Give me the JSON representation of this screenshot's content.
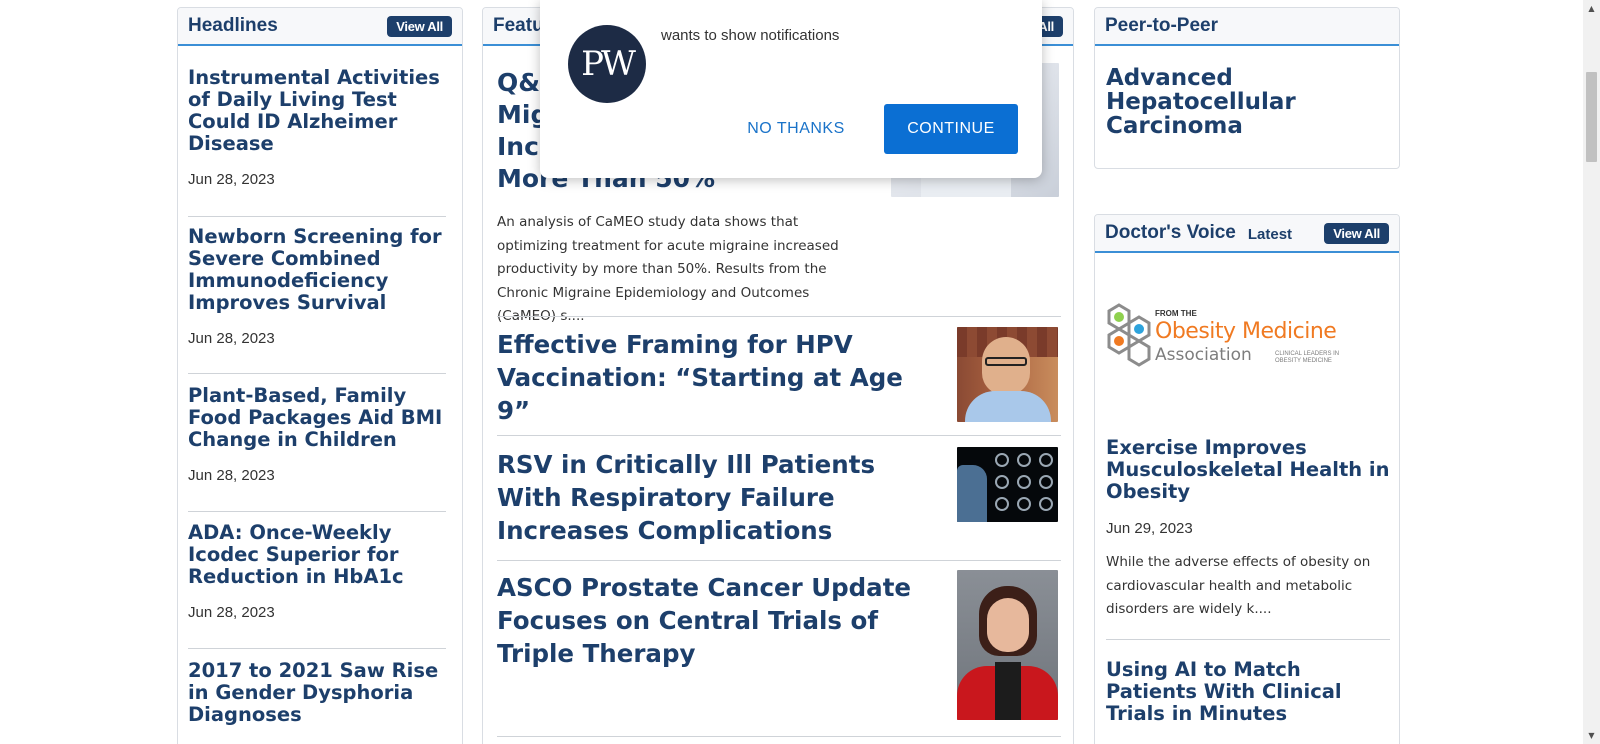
{
  "headlines": {
    "title": "Headlines",
    "view_all": "View All",
    "items": [
      {
        "title": "Instrumental Activities of Daily Living Test Could ID Alzheimer Disease",
        "date": "Jun 28, 2023"
      },
      {
        "title": "Newborn Screening for Severe Combined Immunodeficiency Improves Survival",
        "date": "Jun 28, 2023"
      },
      {
        "title": "Plant-Based, Family Food Packages Aid BMI Change in Children",
        "date": "Jun 28, 2023"
      },
      {
        "title": "ADA: Once-Weekly Icodec Superior for Reduction in HbA1c",
        "date": "Jun 28, 2023"
      },
      {
        "title": "2017 to 2021 Saw Rise in Gender Dysphoria Diagnoses",
        "date": ""
      }
    ]
  },
  "featured": {
    "title_partial": "Featu",
    "view_all_partial": "All",
    "lead": {
      "title_lines": [
        "Q&A",
        "Mig",
        "Incr",
        "More Than 50%"
      ],
      "excerpt": "An analysis of CaMEO study data shows that optimizing treatment for acute migraine increased productivity by more than 50%. Results from the Chronic Migraine Epidemiology and Outcomes (CaMEO) s...."
    },
    "items": [
      {
        "title": "Effective Framing for HPV Vaccination: “Starting at Age 9”"
      },
      {
        "title": "RSV in Critically Ill Patients With Respiratory Failure Increases Complications"
      },
      {
        "title": "ASCO Prostate Cancer Update Focuses on Central Trials of Triple Therapy"
      }
    ]
  },
  "peer": {
    "title": "Peer-to-Peer",
    "item_title": "Advanced Hepatocellular Carcinoma"
  },
  "doctors_voice": {
    "title": "Doctor's Voice",
    "sub": "Latest",
    "view_all": "View All",
    "logo": {
      "from_the": "FROM THE",
      "line1": "Obesity Medicine",
      "line2": "Association",
      "tagline": "CLINICAL LEADERS IN OBESITY MEDICINE"
    },
    "items": [
      {
        "title": "Exercise Improves Musculoskeletal Health in Obesity",
        "date": "Jun 29, 2023",
        "excerpt": "While the adverse effects of obesity on cardiovascular health and metabolic disorders are widely k...."
      },
      {
        "title": "Using AI to Match Patients With Clinical Trials in Minutes"
      }
    ]
  },
  "notification": {
    "logo_text": "PW",
    "message": "wants to show notifications",
    "decline": "NO THANKS",
    "accept": "CONTINUE"
  },
  "colors": {
    "brand_navy": "#1d3f6b",
    "accent_blue": "#3b8fd6",
    "cta_blue": "#0b6fd3",
    "obesity_orange": "#f07a22"
  }
}
